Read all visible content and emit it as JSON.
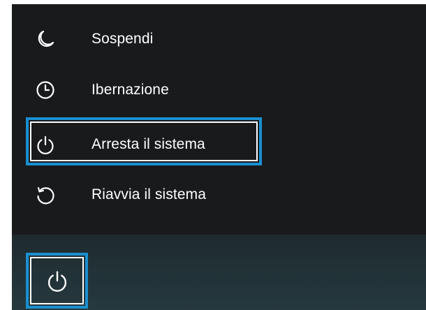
{
  "power_menu": {
    "items": [
      {
        "label": "Sospendi",
        "icon": "moon-icon"
      },
      {
        "label": "Ibernazione",
        "icon": "clock-icon"
      },
      {
        "label": "Arresta il sistema",
        "icon": "power-icon"
      },
      {
        "label": "Riavvia il sistema",
        "icon": "restart-icon"
      }
    ],
    "highlighted_item": "Arresta il sistema"
  },
  "taskbar": {
    "power_button_icon": "power-icon"
  },
  "colors": {
    "menu_background": "#181a1c",
    "highlight_border": "#1a8fd0",
    "text": "#ffffff"
  }
}
